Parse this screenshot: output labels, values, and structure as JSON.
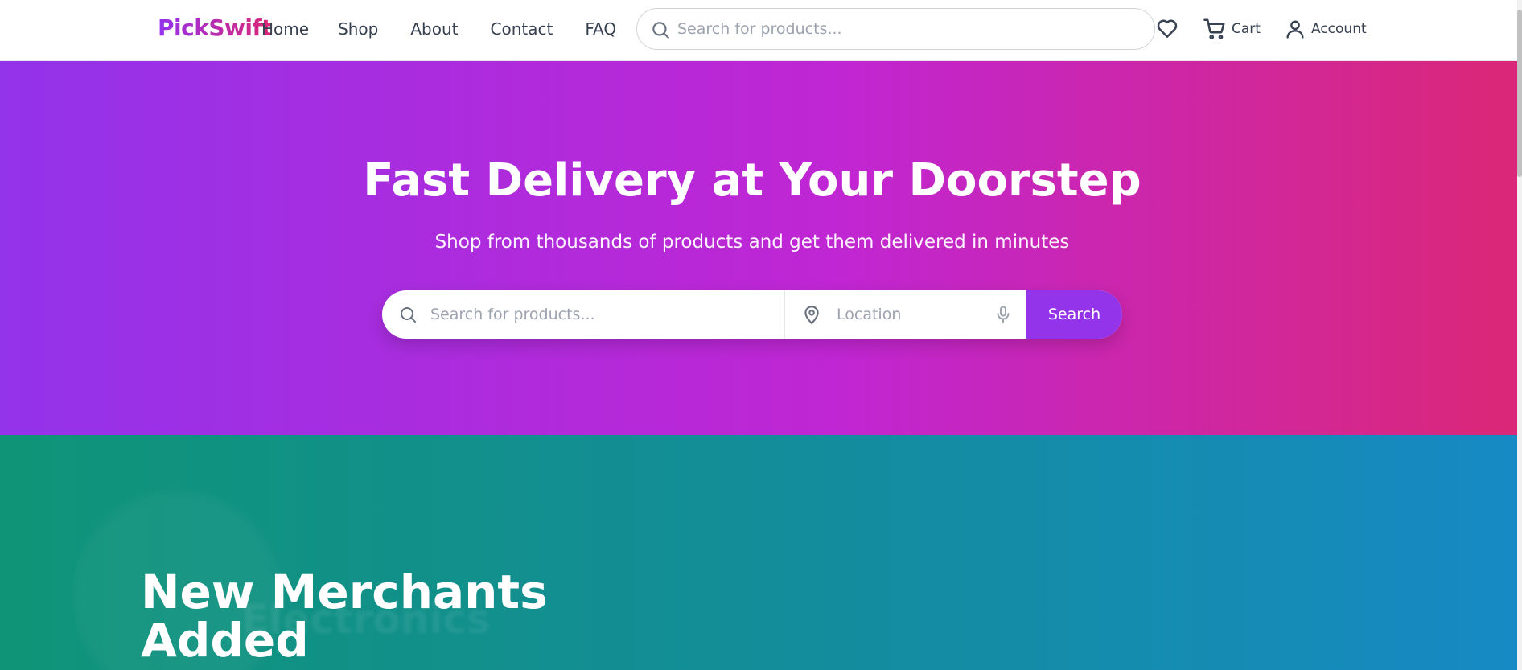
{
  "header": {
    "logo": "PickSwift",
    "nav": [
      "Home",
      "Shop",
      "About",
      "Contact",
      "FAQ"
    ],
    "search": {
      "placeholder": "Search for products..."
    },
    "cart_label": "Cart",
    "account_label": "Account",
    "icons": [
      "search-icon",
      "heart-icon",
      "cart-icon",
      "user-icon"
    ]
  },
  "hero": {
    "title": "Fast Delivery at Your Doorstep",
    "subtitle": "Shop from thousands of products and get them delivered in minutes",
    "search_placeholder": "Search for products...",
    "location_placeholder": "Location",
    "search_button": "Search",
    "icons": [
      "search-icon",
      "location-pin-icon",
      "microphone-icon"
    ]
  },
  "merchants": {
    "title": "New Merchants Added",
    "background_caption": "Electronics"
  },
  "colors": {
    "brand_purple": "#9333ea",
    "brand_pink": "#db2777",
    "merchants_teal": "#0f9477",
    "merchants_blue": "#168ac4"
  }
}
